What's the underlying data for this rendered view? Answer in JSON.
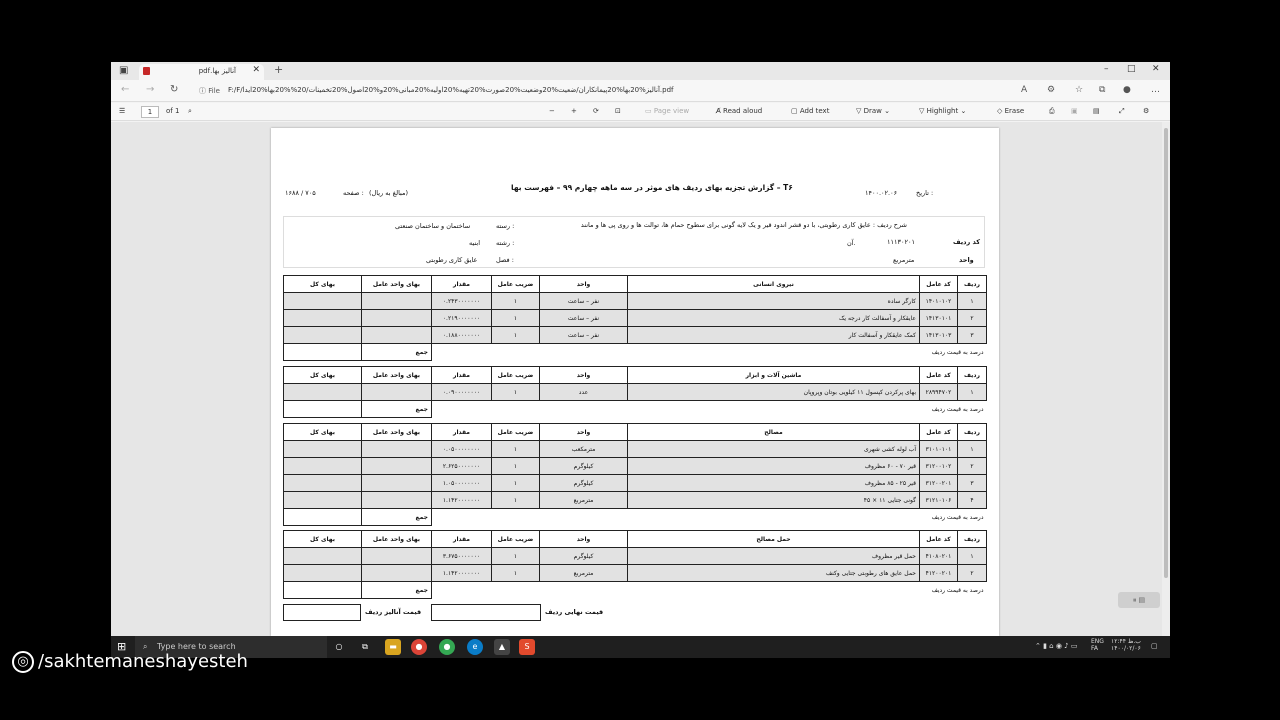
{
  "browser": {
    "tab_title": "آنالیز بها.pdf",
    "new_tab": "+",
    "file_label": "File",
    "url": "F:/F/آنالیز%20بها%20پیمانکاران/ضعیت%20وضعیت%20صورت%20تهیه%20اولیه%20مبانی%20و%20اصول%20تخمینات/20%%20بها%20ایدا.pdf",
    "min": "–",
    "max": "□",
    "close": "✕"
  },
  "pdf_toolbar": {
    "page_value": "1",
    "page_total": "of 1",
    "page_view": "Page view",
    "read_aloud": "Read aloud",
    "add_text": "Add text",
    "draw": "Draw",
    "highlight": "Highlight",
    "erase": "Erase"
  },
  "doc": {
    "date_label": "تاریخ :",
    "date_value": "۱۴۰۰.۰۲.۰۶",
    "title": "T۶ – گزارش تجزیه بهای ردیف های موثر در سه ماهه چهارم ۹۹ – فهرست بها",
    "unit_note": "(مبالغ به ریال)",
    "page_label": "صفحه :",
    "page_value": "۱۶۸۸ / ۷۰۵",
    "desc_label": "شرح ردیف :",
    "desc_text": "عایق کاری رطوبتی، با دو قشر اندود قیر و یک لایه گونی برای سطوح حمام ها، توالت ها و روی پی ها و مانند",
    "desc_cont": "آن.",
    "code_label": "کد ردیف",
    "code_value": "۱۱۱۳۰۲۰۱",
    "unit_label": "واحد",
    "unit_value": "مترمربع",
    "field_label": "رسته :",
    "field_value": "ساختمان و ساختمان صنعتی",
    "branch_label": "رشته :",
    "branch_value": "ابنیه",
    "chapter_label": "فصل :",
    "chapter_value": "عایق کاری رطوبتی",
    "col_total": "بهای کل",
    "col_unit_price": "بهای واحد عامل",
    "col_amount": "مقدار",
    "col_factor": "ضریب عامل",
    "col_unit": "واحد",
    "col_code": "کد عامل",
    "col_row": "ردیف",
    "sum": "جمع",
    "percent": "درصد به قیمت ردیف",
    "section_labor": "نیروی انسانی",
    "section_machine": "ماشین آلات و ابزار",
    "section_material": "مصالح",
    "section_transport": "حمل مصالح",
    "labor": [
      {
        "row": "۱",
        "code": "۱۴۰۱۰۱۰۲",
        "name": "کارگر ساده",
        "unit": "نفر – ساعت",
        "factor": "۱",
        "amount": "۰.۲۴۳۰۰۰۰۰۰۰"
      },
      {
        "row": "۲",
        "code": "۱۴۱۳۰۱۰۱",
        "name": "عایقکار و آسفالت کار درجه یک",
        "unit": "نفر – ساعت",
        "factor": "۱",
        "amount": "۰.۲۱۹۰۰۰۰۰۰۰"
      },
      {
        "row": "۳",
        "code": "۱۴۱۳۰۱۰۳",
        "name": "کمک عایقکار و آسفالت کار",
        "unit": "نفر – ساعت",
        "factor": "۱",
        "amount": "۰.۱۸۸۰۰۰۰۰۰۰"
      }
    ],
    "machine": [
      {
        "row": "۱",
        "code": "۲۸۹۹۴۷۰۲",
        "name": "بهای پرکردن کپسول ۱۱ کیلویی بوتان وپروپان",
        "unit": "عدد",
        "factor": "۱",
        "amount": "۰.۰۹۰۰۰۰۰۰۰۰"
      }
    ],
    "material": [
      {
        "row": "۱",
        "code": "۳۱۰۱۰۱۰۱",
        "name": "آب لوله کشی شهری",
        "unit": "مترمکعب",
        "factor": "۱",
        "amount": "۰.۰۵۰۰۰۰۰۰۰۰"
      },
      {
        "row": "۲",
        "code": "۳۱۲۰۰۱۰۲",
        "name": "قیر ۷۰ - ۶۰ مظروف",
        "unit": "کیلوگرم",
        "factor": "۱",
        "amount": "۲.۶۲۵۰۰۰۰۰۰۰"
      },
      {
        "row": "۳",
        "code": "۳۱۲۰۰۲۰۱",
        "name": "قیر ۲۵ - ۸۵ مظروف",
        "unit": "کیلوگرم",
        "factor": "۱",
        "amount": "۱.۰۵۰۰۰۰۰۰۰۰"
      },
      {
        "row": "۴",
        "code": "۳۱۲۱۰۱۰۶",
        "name": "گونی جتایی ۱۱ × ۴۵",
        "unit": "مترمربع",
        "factor": "۱",
        "amount": "۱.۱۴۲۰۰۰۰۰۰۰"
      }
    ],
    "transport": [
      {
        "row": "۱",
        "code": "۴۱۰۸۰۲۰۱",
        "name": "حمل قیر مظروف",
        "unit": "کیلوگرم",
        "factor": "۱",
        "amount": "۳.۶۷۵۰۰۰۰۰۰۰"
      },
      {
        "row": "۲",
        "code": "۴۱۲۰۰۲۰۱",
        "name": "حمل عایق های رطوبتی جتایی وکنف",
        "unit": "مترمربع",
        "factor": "۱",
        "amount": "۱.۱۴۲۰۰۰۰۰۰۰"
      }
    ],
    "final_row_price": "قیمت نهایی ردیف",
    "analysis_price": "قیمت آنالیز ردیف"
  },
  "taskbar": {
    "search_placeholder": "Type here to search",
    "lang1": "FA",
    "lang2": "ENG",
    "time": "۱۲:۴۴ ب.ظ",
    "date": "۱۴۰۰/۰۲/۰۶"
  },
  "watermark": "/sakhtemaneshayesteh"
}
